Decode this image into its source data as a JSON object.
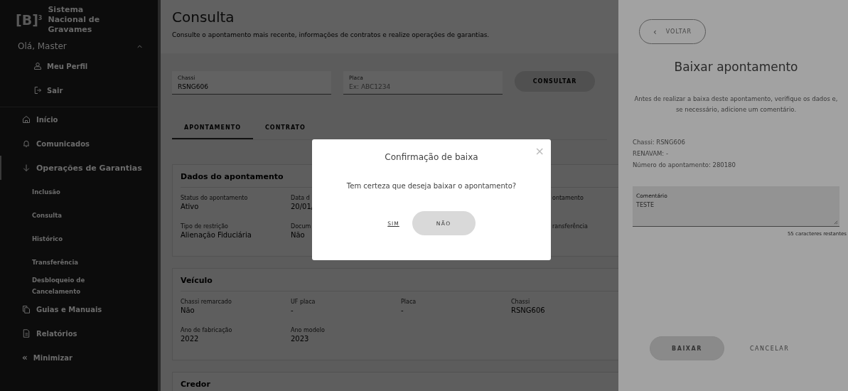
{
  "sidebar": {
    "logo": {
      "mark": "[B]",
      "superscript": "3",
      "name": "Sistema Nacional de Gravames"
    },
    "user": {
      "greeting": "Olá, Master",
      "expanded": true,
      "items": [
        {
          "label": "Meu Perfil"
        },
        {
          "label": "Sair"
        }
      ]
    },
    "items": [
      {
        "label": "Início",
        "selected": false
      },
      {
        "label": "Comunicados",
        "selected": false
      },
      {
        "label": "Operações de Garantias",
        "selected": true,
        "children": [
          {
            "label": "Inclusão"
          },
          {
            "label": "Consulta"
          },
          {
            "label": "Histórico"
          },
          {
            "label": "Transferência"
          },
          {
            "label": "Desbloqueio de Cancelamento"
          }
        ]
      },
      {
        "label": "Guias e Manuais",
        "selected": false
      },
      {
        "label": "Relatórios",
        "selected": false
      }
    ],
    "minimize": {
      "icon": "«",
      "label": "Minimizar"
    }
  },
  "page": {
    "title": "Consulta",
    "subtitle": "Consulte o apontamento mais recente, informações de contratos e realize operações de garantias.",
    "fields": [
      {
        "label": "Chassi",
        "value": "RSNG606"
      },
      {
        "label": "Placa",
        "placeholder": "Ex: ABC1234"
      }
    ],
    "search_button": "CONSULTAR",
    "tabs": [
      {
        "label": "APONTAMENTO",
        "selected": true
      },
      {
        "label": "CONTRATO",
        "selected": false
      }
    ],
    "cards": [
      {
        "title": "Dados do apontamento",
        "rows": [
          [
            {
              "label": "Status do apontamento",
              "value": "Ativo"
            },
            {
              "label": "Data d",
              "value": "20/01/"
            },
            null,
            {
              "label": "ontamento",
              "partial": true
            }
          ],
          [
            {
              "label": "Tipo de restrição",
              "value": "Alienação Fiduciária"
            },
            {
              "label": "Docum",
              "value": "Não"
            },
            null,
            {
              "label": "ransferência",
              "partial": true
            }
          ]
        ]
      },
      {
        "title": "Veículo",
        "rows": [
          [
            {
              "label": "Chassi remarcado",
              "value": "Não"
            },
            {
              "label": "UF placa",
              "value": "-"
            },
            {
              "label": "Placa",
              "value": "-"
            },
            {
              "label": "Chassi",
              "value": "RSNG606"
            }
          ],
          [
            {
              "label": "Ano de fabricação",
              "value": "2022"
            },
            {
              "label": "Ano modelo",
              "value": "2023"
            }
          ]
        ]
      },
      {
        "title": "Credor"
      }
    ]
  },
  "modal": {
    "title": "Confirmação de baixa",
    "message": "Tem certeza que deseja baixar o apontamento?",
    "close": "×",
    "buttons": [
      {
        "label": "SIM",
        "kind": "link"
      },
      {
        "label": "NÃO",
        "kind": "filled"
      }
    ]
  },
  "panel": {
    "back": {
      "icon": "‹",
      "label": "VOLTAR"
    },
    "title": "Baixar apontamento",
    "description": "Antes de realizar a baixa deste apontamento, verifique os dados e, se necessário, adicione um comentário.",
    "details": [
      "Chassi: RSNG606",
      "RENAVAM: -",
      "Número do apontamento: 280180"
    ],
    "comment": {
      "label": "Comentário",
      "value": "TESTE"
    },
    "counter": "55 caracteres restantes",
    "buttons": [
      {
        "label": "BAIXAR",
        "kind": "filled"
      },
      {
        "label": "CANCELAR",
        "kind": "text"
      }
    ]
  }
}
